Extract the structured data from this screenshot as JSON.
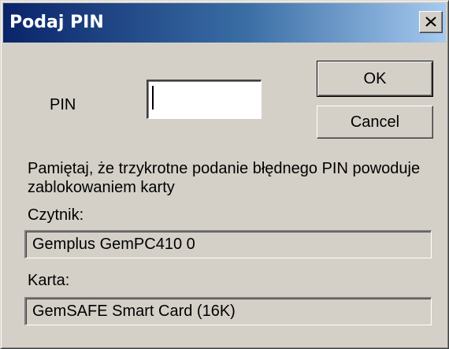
{
  "window": {
    "title": "Podaj PIN"
  },
  "pin": {
    "label": "PIN",
    "value": "",
    "placeholder": ""
  },
  "buttons": {
    "ok_label": "OK",
    "cancel_label": "Cancel"
  },
  "message": "Pamiętaj, że trzykrotne podanie błędnego PIN powoduje zablokowaniem karty",
  "reader": {
    "label": "Czytnik:",
    "value": "Gemplus GemPC410 0"
  },
  "card": {
    "label": "Karta:",
    "value": "GemSAFE Smart Card (16K)"
  },
  "icons": {
    "close": "close-icon"
  },
  "colors": {
    "titlebar_start": "#0a246a",
    "titlebar_end": "#a6caf0",
    "dialog_face": "#d4d0c8"
  }
}
